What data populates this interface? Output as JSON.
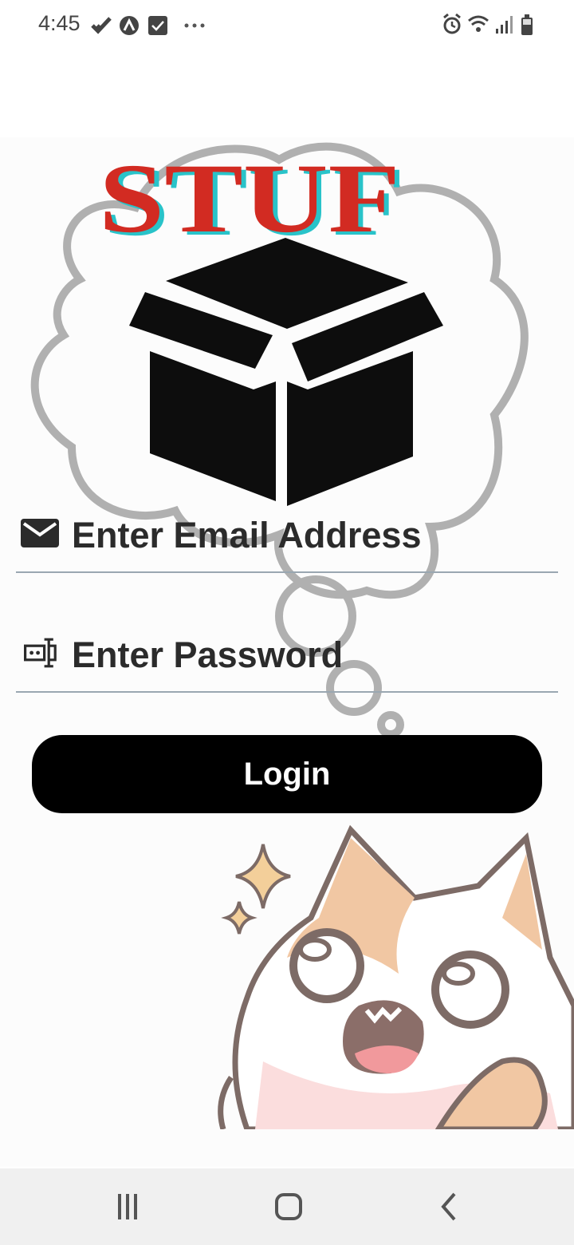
{
  "status_bar": {
    "time": "4:45",
    "left_icons": [
      "check-icon",
      "app-a-icon",
      "checkbox-icon",
      "more-dots-icon"
    ],
    "right_icons": [
      "alarm-icon",
      "wifi-icon",
      "signal-icon",
      "battery-icon"
    ]
  },
  "app": {
    "logo_text": "STUF",
    "logo_color": "#d22b22"
  },
  "login_form": {
    "email_placeholder": "Enter Email Address",
    "password_placeholder": "Enter Password",
    "login_label": "Login",
    "button_color": "#000000"
  },
  "nav_bar": {
    "buttons": [
      "recent-apps",
      "home",
      "back"
    ]
  }
}
